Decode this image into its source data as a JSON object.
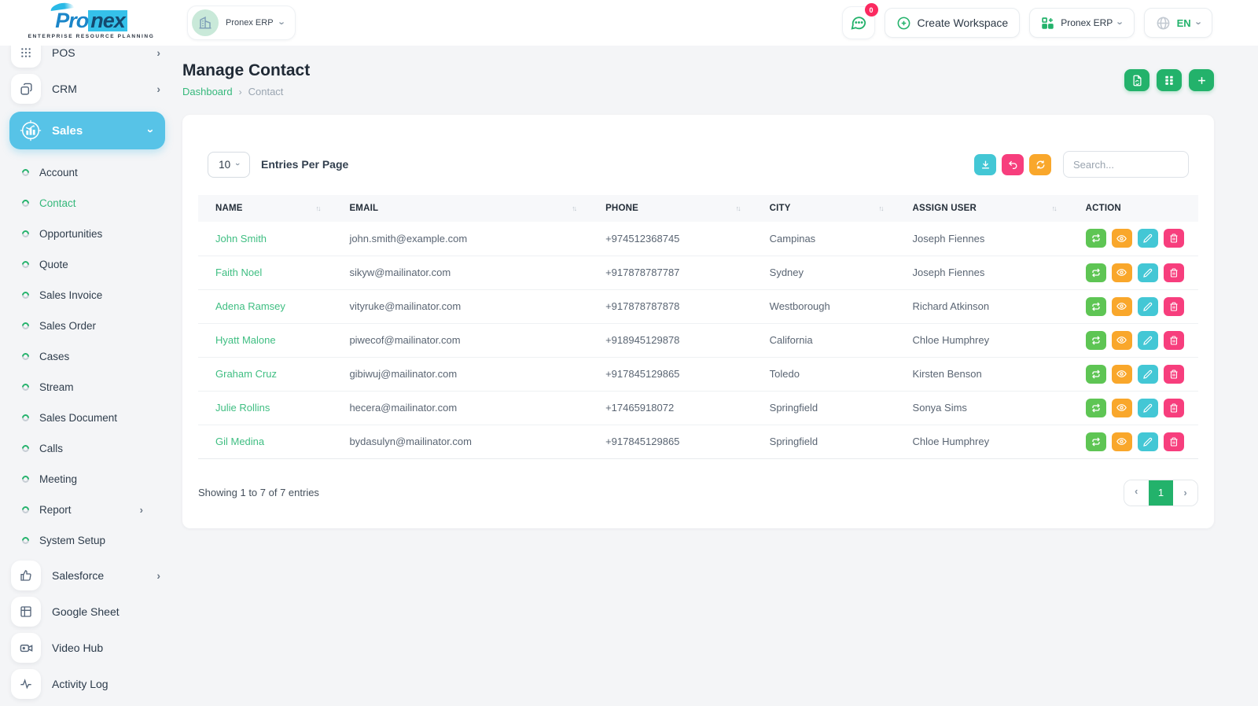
{
  "brand": {
    "logo_pro": "Pro",
    "logo_nex": "nex",
    "tagline": "ENTERPRISE RESOURCE PLANNING"
  },
  "topbar": {
    "workspace_chip_label": "Pronex ERP",
    "messages_badge": "0",
    "create_workspace_label": "Create Workspace",
    "workspace_dropdown_label": "Pronex ERP",
    "language_label": "EN"
  },
  "icons": {
    "chevron_right": "›",
    "sort_glyph": "↑↓"
  },
  "sidebar": {
    "pos_label": "POS",
    "crm_label": "CRM",
    "sales_label": "Sales",
    "sales_subitems": [
      {
        "label": "Account"
      },
      {
        "label": "Contact",
        "active": true
      },
      {
        "label": "Opportunities"
      },
      {
        "label": "Quote"
      },
      {
        "label": "Sales Invoice"
      },
      {
        "label": "Sales Order"
      },
      {
        "label": "Cases"
      },
      {
        "label": "Stream"
      },
      {
        "label": "Sales Document"
      },
      {
        "label": "Calls"
      },
      {
        "label": "Meeting"
      },
      {
        "label": "Report",
        "chevron": true
      },
      {
        "label": "System Setup"
      }
    ],
    "salesforce_label": "Salesforce",
    "google_sheet_label": "Google Sheet",
    "video_hub_label": "Video Hub",
    "activity_log_label": "Activity Log"
  },
  "page": {
    "title": "Manage Contact",
    "breadcrumb_home": "Dashboard",
    "breadcrumb_current": "Contact"
  },
  "table_controls": {
    "entries_value": "10",
    "entries_label": "Entries Per Page",
    "search_placeholder": "Search..."
  },
  "table": {
    "columns": [
      {
        "label": "NAME",
        "sort": true
      },
      {
        "label": "EMAIL",
        "sort": true
      },
      {
        "label": "PHONE",
        "sort": true
      },
      {
        "label": "CITY",
        "sort": true
      },
      {
        "label": "ASSIGN USER",
        "sort": true
      },
      {
        "label": "ACTION",
        "sort": false
      }
    ],
    "rows": [
      {
        "name": "John Smith",
        "email": "john.smith@example.com",
        "phone": "+974512368745",
        "city": "Campinas",
        "assign_user": "Joseph Fiennes"
      },
      {
        "name": "Faith Noel",
        "email": "sikyw@mailinator.com",
        "phone": "+917878787787",
        "city": "Sydney",
        "assign_user": "Joseph Fiennes"
      },
      {
        "name": "Adena Ramsey",
        "email": "vityruke@mailinator.com",
        "phone": "+917878787878",
        "city": "Westborough",
        "assign_user": "Richard Atkinson"
      },
      {
        "name": "Hyatt Malone",
        "email": "piwecof@mailinator.com",
        "phone": "+918945129878",
        "city": "California",
        "assign_user": "Chloe Humphrey"
      },
      {
        "name": "Graham Cruz",
        "email": "gibiwuj@mailinator.com",
        "phone": "+917845129865",
        "city": "Toledo",
        "assign_user": "Kirsten Benson"
      },
      {
        "name": "Julie Rollins",
        "email": "hecera@mailinator.com",
        "phone": "+17465918072",
        "city": "Springfield",
        "assign_user": "Sonya Sims"
      },
      {
        "name": "Gil Medina",
        "email": "bydasulyn@mailinator.com",
        "phone": "+917845129865",
        "city": "Springfield",
        "assign_user": "Chloe Humphrey"
      }
    ]
  },
  "footer": {
    "showing_text": "Showing 1 to 7 of 7 entries",
    "page_number": "1"
  },
  "colors": {
    "accent_green": "#23b26b",
    "link_green": "#3fbe82",
    "active_sky": "#57c3e7",
    "cyan": "#43c7d5",
    "pink": "#f73e7d",
    "orange": "#f9a72b",
    "lime": "#5ec554",
    "badge_red": "#fb2a60"
  }
}
